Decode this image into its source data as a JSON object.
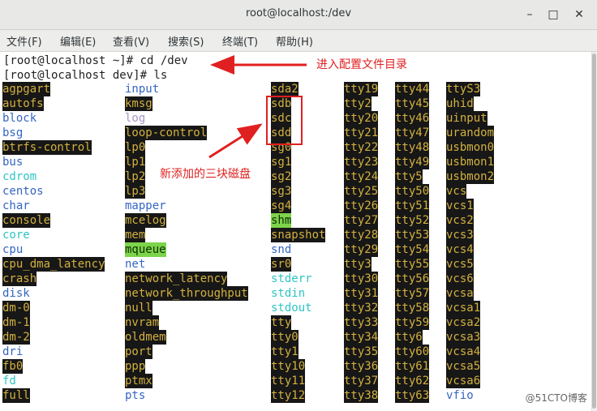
{
  "window": {
    "title": "root@localhost:/dev"
  },
  "menu": [
    {
      "label": "文件(F)"
    },
    {
      "label": "编辑(E)"
    },
    {
      "label": "查看(V)"
    },
    {
      "label": "搜索(S)"
    },
    {
      "label": "终端(T)"
    },
    {
      "label": "帮助(H)"
    }
  ],
  "prompt_lines": [
    "[root@localhost ~]# cd /dev",
    "[root@localhost dev]# ls"
  ],
  "columns": [
    [
      {
        "t": "agpgart",
        "c": "yel"
      },
      {
        "t": "autofs",
        "c": "yel"
      },
      {
        "t": "block",
        "c": "blue"
      },
      {
        "t": "bsg",
        "c": "blue"
      },
      {
        "t": "btrfs-control",
        "c": "yel"
      },
      {
        "t": "bus",
        "c": "blue"
      },
      {
        "t": "cdrom",
        "c": "cyan"
      },
      {
        "t": "centos",
        "c": "blue"
      },
      {
        "t": "char",
        "c": "blue"
      },
      {
        "t": "console",
        "c": "yel"
      },
      {
        "t": "core",
        "c": "cyan"
      },
      {
        "t": "cpu",
        "c": "blue"
      },
      {
        "t": "cpu_dma_latency",
        "c": "yel"
      },
      {
        "t": "crash",
        "c": "yel"
      },
      {
        "t": "disk",
        "c": "blue"
      },
      {
        "t": "dm-0",
        "c": "yel"
      },
      {
        "t": "dm-1",
        "c": "yel"
      },
      {
        "t": "dm-2",
        "c": "yel"
      },
      {
        "t": "dri",
        "c": "blue"
      },
      {
        "t": "fb0",
        "c": "yel"
      },
      {
        "t": "fd",
        "c": "cyan"
      },
      {
        "t": "full",
        "c": "yel"
      }
    ],
    [
      {
        "t": "input",
        "c": "blue"
      },
      {
        "t": "kmsg",
        "c": "yel"
      },
      {
        "t": "log",
        "c": "gray"
      },
      {
        "t": "loop-control",
        "c": "yel"
      },
      {
        "t": "lp0",
        "c": "yel"
      },
      {
        "t": "lp1",
        "c": "yel"
      },
      {
        "t": "lp2",
        "c": "yel"
      },
      {
        "t": "lp3",
        "c": "yel"
      },
      {
        "t": "mapper",
        "c": "blue"
      },
      {
        "t": "mcelog",
        "c": "yel"
      },
      {
        "t": "mem",
        "c": "yel"
      },
      {
        "t": "mqueue",
        "c": "green"
      },
      {
        "t": "net",
        "c": "blue"
      },
      {
        "t": "network_latency",
        "c": "yel"
      },
      {
        "t": "network_throughput",
        "c": "yel"
      },
      {
        "t": "null",
        "c": "yel"
      },
      {
        "t": "nvram",
        "c": "yel"
      },
      {
        "t": "oldmem",
        "c": "yel"
      },
      {
        "t": "port",
        "c": "yel"
      },
      {
        "t": "ppp",
        "c": "yel"
      },
      {
        "t": "ptmx",
        "c": "yel"
      },
      {
        "t": "pts",
        "c": "blue"
      }
    ],
    [
      {
        "t": "sda2",
        "c": "yel"
      },
      {
        "t": "sdb",
        "c": "yel"
      },
      {
        "t": "sdc",
        "c": "yel"
      },
      {
        "t": "sdd",
        "c": "yel"
      },
      {
        "t": "sg0",
        "c": "yel"
      },
      {
        "t": "sg1",
        "c": "yel"
      },
      {
        "t": "sg2",
        "c": "yel"
      },
      {
        "t": "sg3",
        "c": "yel"
      },
      {
        "t": "sg4",
        "c": "yel"
      },
      {
        "t": "shm",
        "c": "green"
      },
      {
        "t": "snapshot",
        "c": "yel"
      },
      {
        "t": "snd",
        "c": "blue"
      },
      {
        "t": "sr0",
        "c": "yel"
      },
      {
        "t": "stderr",
        "c": "cyan"
      },
      {
        "t": "stdin",
        "c": "cyan"
      },
      {
        "t": "stdout",
        "c": "cyan"
      },
      {
        "t": "tty",
        "c": "yel"
      },
      {
        "t": "tty0",
        "c": "yel"
      },
      {
        "t": "tty1",
        "c": "yel"
      },
      {
        "t": "tty10",
        "c": "yel"
      },
      {
        "t": "tty11",
        "c": "yel"
      },
      {
        "t": "tty12",
        "c": "yel"
      }
    ],
    [
      {
        "t": "tty19",
        "c": "yel"
      },
      {
        "t": "tty2",
        "c": "yel"
      },
      {
        "t": "tty20",
        "c": "yel"
      },
      {
        "t": "tty21",
        "c": "yel"
      },
      {
        "t": "tty22",
        "c": "yel"
      },
      {
        "t": "tty23",
        "c": "yel"
      },
      {
        "t": "tty24",
        "c": "yel"
      },
      {
        "t": "tty25",
        "c": "yel"
      },
      {
        "t": "tty26",
        "c": "yel"
      },
      {
        "t": "tty27",
        "c": "yel"
      },
      {
        "t": "tty28",
        "c": "yel"
      },
      {
        "t": "tty29",
        "c": "yel"
      },
      {
        "t": "tty3",
        "c": "yel"
      },
      {
        "t": "tty30",
        "c": "yel"
      },
      {
        "t": "tty31",
        "c": "yel"
      },
      {
        "t": "tty32",
        "c": "yel"
      },
      {
        "t": "tty33",
        "c": "yel"
      },
      {
        "t": "tty34",
        "c": "yel"
      },
      {
        "t": "tty35",
        "c": "yel"
      },
      {
        "t": "tty36",
        "c": "yel"
      },
      {
        "t": "tty37",
        "c": "yel"
      },
      {
        "t": "tty38",
        "c": "yel"
      }
    ],
    [
      {
        "t": "tty44",
        "c": "yel"
      },
      {
        "t": "tty45",
        "c": "yel"
      },
      {
        "t": "tty46",
        "c": "yel"
      },
      {
        "t": "tty47",
        "c": "yel"
      },
      {
        "t": "tty48",
        "c": "yel"
      },
      {
        "t": "tty49",
        "c": "yel"
      },
      {
        "t": "tty5",
        "c": "yel"
      },
      {
        "t": "tty50",
        "c": "yel"
      },
      {
        "t": "tty51",
        "c": "yel"
      },
      {
        "t": "tty52",
        "c": "yel"
      },
      {
        "t": "tty53",
        "c": "yel"
      },
      {
        "t": "tty54",
        "c": "yel"
      },
      {
        "t": "tty55",
        "c": "yel"
      },
      {
        "t": "tty56",
        "c": "yel"
      },
      {
        "t": "tty57",
        "c": "yel"
      },
      {
        "t": "tty58",
        "c": "yel"
      },
      {
        "t": "tty59",
        "c": "yel"
      },
      {
        "t": "tty6",
        "c": "yel"
      },
      {
        "t": "tty60",
        "c": "yel"
      },
      {
        "t": "tty61",
        "c": "yel"
      },
      {
        "t": "tty62",
        "c": "yel"
      },
      {
        "t": "tty63",
        "c": "yel"
      }
    ],
    [
      {
        "t": "ttyS3",
        "c": "yel"
      },
      {
        "t": "uhid",
        "c": "yel"
      },
      {
        "t": "uinput",
        "c": "yel"
      },
      {
        "t": "urandom",
        "c": "yel"
      },
      {
        "t": "usbmon0",
        "c": "yel"
      },
      {
        "t": "usbmon1",
        "c": "yel"
      },
      {
        "t": "usbmon2",
        "c": "yel"
      },
      {
        "t": "vcs",
        "c": "yel"
      },
      {
        "t": "vcs1",
        "c": "yel"
      },
      {
        "t": "vcs2",
        "c": "yel"
      },
      {
        "t": "vcs3",
        "c": "yel"
      },
      {
        "t": "vcs4",
        "c": "yel"
      },
      {
        "t": "vcs5",
        "c": "yel"
      },
      {
        "t": "vcs6",
        "c": "yel"
      },
      {
        "t": "vcsa",
        "c": "yel"
      },
      {
        "t": "vcsa1",
        "c": "yel"
      },
      {
        "t": "vcsa2",
        "c": "yel"
      },
      {
        "t": "vcsa3",
        "c": "yel"
      },
      {
        "t": "vcsa4",
        "c": "yel"
      },
      {
        "t": "vcsa5",
        "c": "yel"
      },
      {
        "t": "vcsa6",
        "c": "yel"
      },
      {
        "t": "vfio",
        "c": "blue"
      }
    ]
  ],
  "annotations": {
    "enter_dir": "进入配置文件目录",
    "new_disks": "新添加的三块磁盘",
    "color": "#e02020"
  },
  "watermark": "@51CTO博客"
}
